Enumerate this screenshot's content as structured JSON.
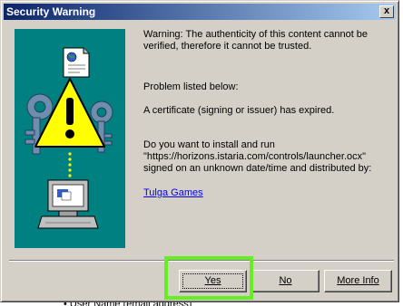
{
  "window": {
    "title": "Security Warning",
    "close_glyph": "x"
  },
  "message": {
    "warning_line1": "Warning: The authenticity of this content cannot be",
    "warning_line2": "verified, therefore it cannot be trusted.",
    "problem_header": "Problem listed below:",
    "problem_text": "A certificate (signing or issuer) has expired.",
    "question_line1": "Do you want to install and run",
    "question_line2": "\"https://horizons.istaria.com/controls/launcher.ocx\"",
    "question_line3": "signed on an unknown date/time and distributed by:",
    "publisher_link": "Tulga Games"
  },
  "buttons": {
    "yes": "Yes",
    "no": "No",
    "more_info": "More Info"
  },
  "background": {
    "partial_text": "• User Name (email address)"
  },
  "colors": {
    "title_gradient_start": "#0a246a",
    "panel_teal": "#008080",
    "highlight_green": "#66ee22",
    "link_blue": "#0000ff",
    "dialog_gray": "#d4d0c8"
  },
  "icons": {
    "illustration": "security-warning-illustration",
    "close": "close-icon"
  }
}
